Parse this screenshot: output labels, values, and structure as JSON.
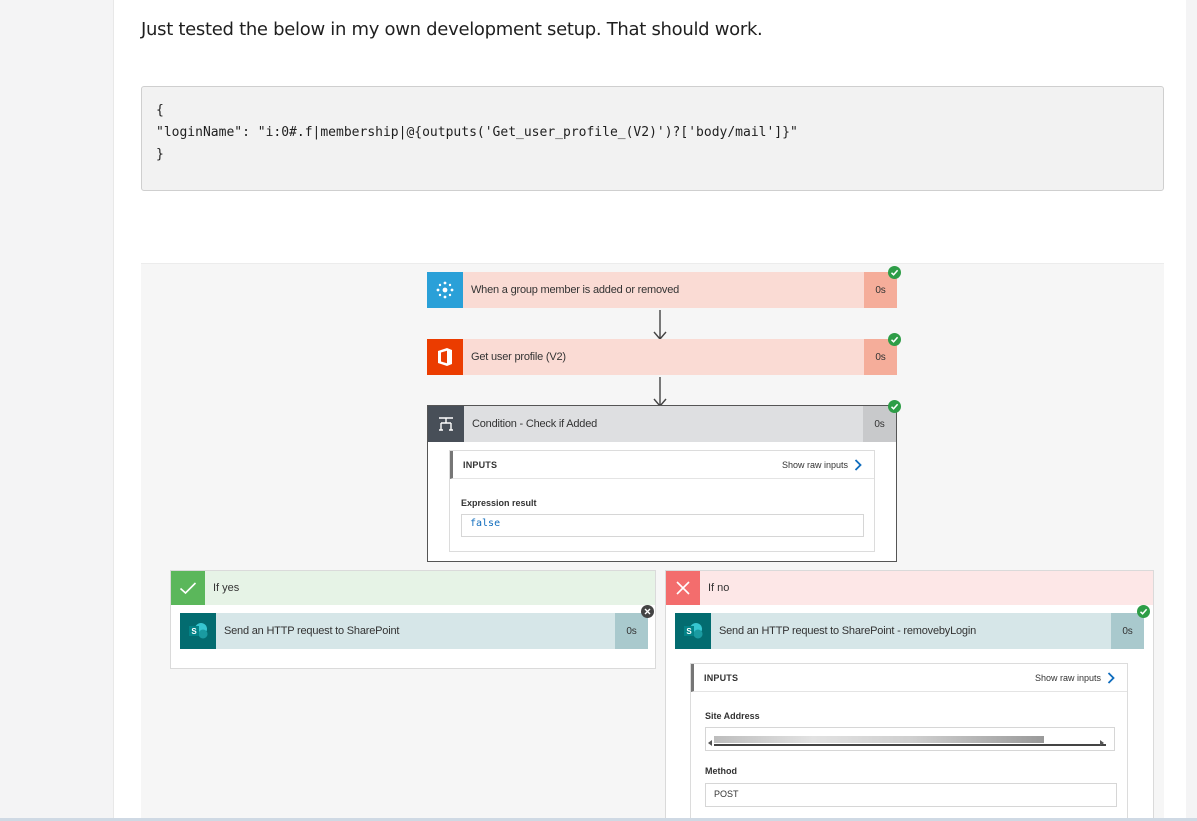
{
  "post": {
    "intro": "Just tested the below in my own development setup. That should work.",
    "code_lines": [
      "{",
      "\"loginName\": \"i:0#.f|membership|@{outputs('Get_user_profile_(V2)')?['body/mail']}\"",
      "}"
    ]
  },
  "flow": {
    "trigger": {
      "title": "When a group member is added or removed",
      "duration": "0s",
      "icon": "group-members-icon",
      "status": "succeeded"
    },
    "profile": {
      "title": "Get user profile (V2)",
      "duration": "0s",
      "icon": "office-icon",
      "status": "succeeded"
    },
    "condition": {
      "title": "Condition - Check if Added",
      "duration": "0s",
      "icon": "condition-icon",
      "status": "succeeded",
      "inputs_label": "INPUTS",
      "show_raw": "Show raw inputs",
      "expression_label": "Expression result",
      "expression_value": "false"
    },
    "if_yes": {
      "label": "If yes",
      "action": {
        "title": "Send an HTTP request to SharePoint",
        "duration": "0s",
        "status": "skipped"
      }
    },
    "if_no": {
      "label": "If no",
      "action": {
        "title": "Send an HTTP request to SharePoint - removebyLogin",
        "duration": "0s",
        "status": "succeeded",
        "inputs_label": "INPUTS",
        "show_raw": "Show raw inputs",
        "site_address_label": "Site Address",
        "method_label": "Method",
        "method_value": "POST"
      }
    }
  },
  "colors": {
    "success_step": "#fadbd4",
    "success_duration": "#f5ad9a",
    "condition_bg": "#dedfe1",
    "condition_duration": "#c8c9cb",
    "yes_header": "#e6f3e6",
    "yes_icon": "#5bb75b",
    "no_header": "#fde7e7",
    "no_icon": "#f36d6d",
    "sharepoint_step": "#d6e6e8",
    "sharepoint_duration": "#a9c9cd",
    "sharepoint_icon": "#036c70",
    "check_green": "#2e9d47",
    "link_blue": "#0f6cbd",
    "code_blue": "#0f6cbd"
  }
}
